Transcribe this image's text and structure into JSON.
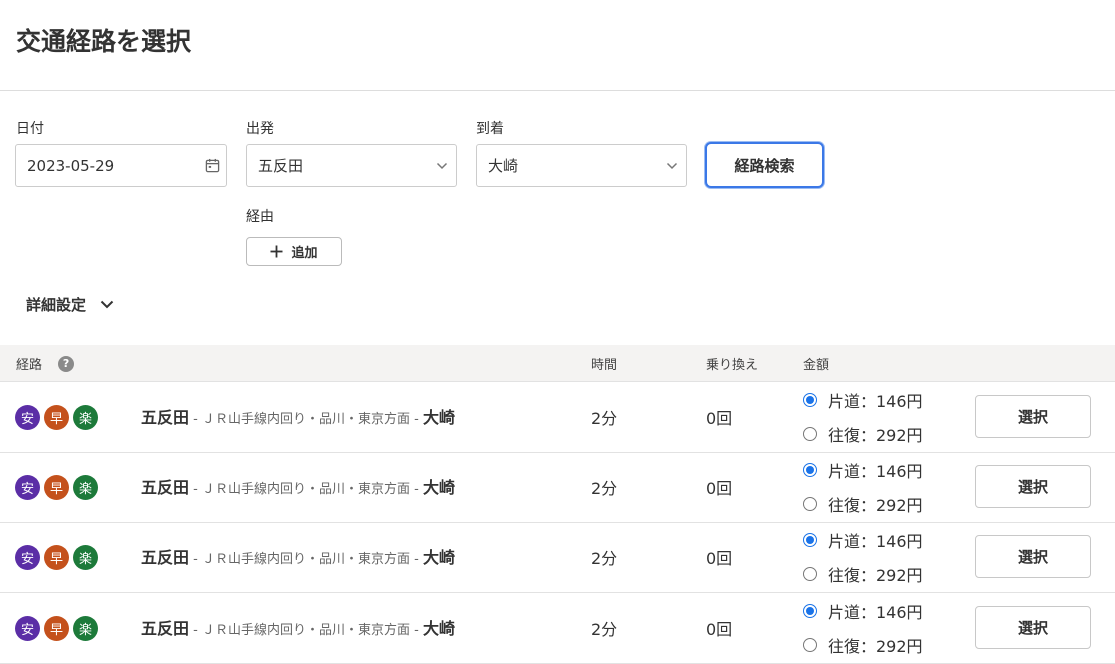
{
  "page": {
    "title": "交通経路を選択"
  },
  "form": {
    "date_label": "日付",
    "date_value": "2023-05-29",
    "depart_label": "出発",
    "depart_value": "五反田",
    "arrive_label": "到着",
    "arrive_value": "大崎",
    "search_label": "経路検索",
    "via_label": "経由",
    "add_label": "追加",
    "details_label": "詳細設定"
  },
  "table": {
    "headers": {
      "route": "経路",
      "time": "時間",
      "transfers": "乗り換え",
      "fare": "金額"
    },
    "rows": [
      {
        "badges": [
          {
            "text": "安",
            "color": "#5b2ea6"
          },
          {
            "text": "早",
            "color": "#c4511c"
          },
          {
            "text": "楽",
            "color": "#1d7a3a"
          }
        ],
        "from": "五反田",
        "sep1": " - ",
        "line": "ＪＲ山手線内回り・品川・東京方面",
        "sep2": " - ",
        "to": "大崎",
        "time": "2分",
        "transfers": "0回",
        "oneway": "片道：146円",
        "roundtrip": "往復：292円",
        "select_label": "選択"
      },
      {
        "badges": [
          {
            "text": "安",
            "color": "#5b2ea6"
          },
          {
            "text": "早",
            "color": "#c4511c"
          },
          {
            "text": "楽",
            "color": "#1d7a3a"
          }
        ],
        "from": "五反田",
        "sep1": " - ",
        "line": "ＪＲ山手線内回り・品川・東京方面",
        "sep2": " - ",
        "to": "大崎",
        "time": "2分",
        "transfers": "0回",
        "oneway": "片道：146円",
        "roundtrip": "往復：292円",
        "select_label": "選択"
      },
      {
        "badges": [
          {
            "text": "安",
            "color": "#5b2ea6"
          },
          {
            "text": "早",
            "color": "#c4511c"
          },
          {
            "text": "楽",
            "color": "#1d7a3a"
          }
        ],
        "from": "五反田",
        "sep1": " - ",
        "line": "ＪＲ山手線内回り・品川・東京方面",
        "sep2": " - ",
        "to": "大崎",
        "time": "2分",
        "transfers": "0回",
        "oneway": "片道：146円",
        "roundtrip": "往復：292円",
        "select_label": "選択"
      },
      {
        "badges": [
          {
            "text": "安",
            "color": "#5b2ea6"
          },
          {
            "text": "早",
            "color": "#c4511c"
          },
          {
            "text": "楽",
            "color": "#1d7a3a"
          }
        ],
        "from": "五反田",
        "sep1": " - ",
        "line": "ＪＲ山手線内回り・品川・東京方面",
        "sep2": " - ",
        "to": "大崎",
        "time": "2分",
        "transfers": "0回",
        "oneway": "片道：146円",
        "roundtrip": "往復：292円",
        "select_label": "選択"
      }
    ]
  }
}
